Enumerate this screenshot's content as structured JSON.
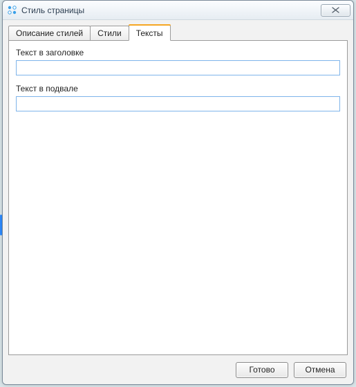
{
  "window": {
    "title": "Стиль страницы"
  },
  "tabs": [
    {
      "label": "Описание стилей",
      "active": false
    },
    {
      "label": "Стили",
      "active": false
    },
    {
      "label": "Тексты",
      "active": true
    }
  ],
  "fields": {
    "header_label": "Текст в заголовке",
    "header_value": "",
    "footer_label": "Текст в подвале",
    "footer_value": ""
  },
  "buttons": {
    "ok": "Готово",
    "cancel": "Отмена"
  }
}
